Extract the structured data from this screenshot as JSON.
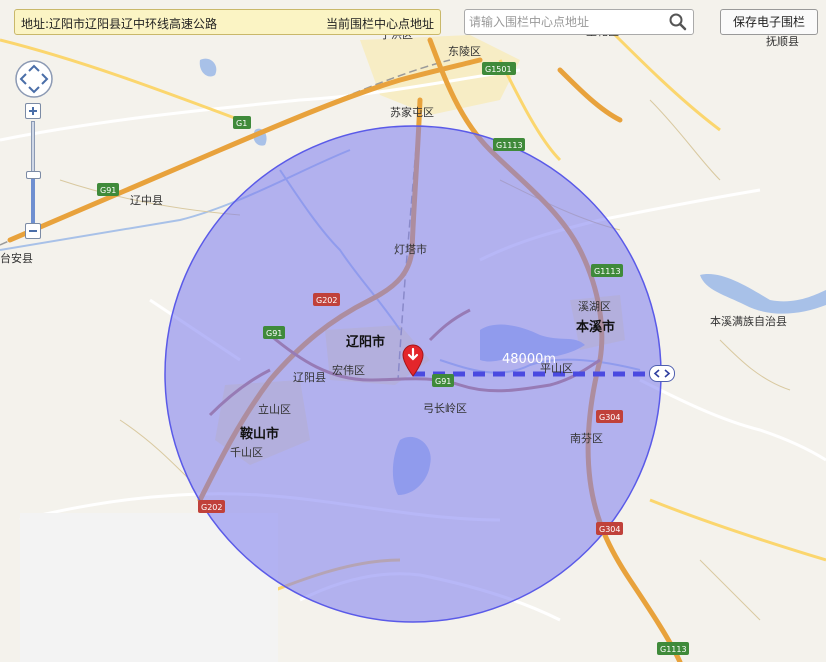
{
  "toolbar": {
    "address_label": "地址:",
    "address_value": "辽阳市辽阳县辽中环线高速公路",
    "set_center_label": "当前围栏中心点地址",
    "search_placeholder": "请输入围栏中心点地址",
    "save_label": "保存电子围栏"
  },
  "fence": {
    "radius_label": "48000m",
    "fill_color": "#7b7cf0",
    "stroke_color": "#5a5ae8"
  },
  "map": {
    "places": [
      {
        "name": "东陵区"
      },
      {
        "name": "苏家屯区"
      },
      {
        "name": "抚顺县"
      },
      {
        "name": "辽中县"
      },
      {
        "name": "灯塔市"
      },
      {
        "name": "溪湖区"
      },
      {
        "name": "本溪市"
      },
      {
        "name": "本溪满族自治县"
      },
      {
        "name": "辽阳市"
      },
      {
        "name": "宏伟区"
      },
      {
        "name": "辽阳县"
      },
      {
        "name": "平山区"
      },
      {
        "name": "立山区"
      },
      {
        "name": "鞍山市"
      },
      {
        "name": "千山区"
      },
      {
        "name": "弓长岭区"
      },
      {
        "name": "南芬区"
      },
      {
        "name": "台安县"
      },
      {
        "name": "望花区"
      },
      {
        "name": "于洪区"
      }
    ],
    "shields": [
      {
        "code": "G1501",
        "color": "#3f8a3a"
      },
      {
        "code": "G1",
        "color": "#3f8a3a"
      },
      {
        "code": "G91",
        "color": "#3f8a3a"
      },
      {
        "code": "G1113",
        "color": "#3f8a3a"
      },
      {
        "code": "G202",
        "color": "#c0413a"
      },
      {
        "code": "G304",
        "color": "#c0413a"
      }
    ]
  }
}
